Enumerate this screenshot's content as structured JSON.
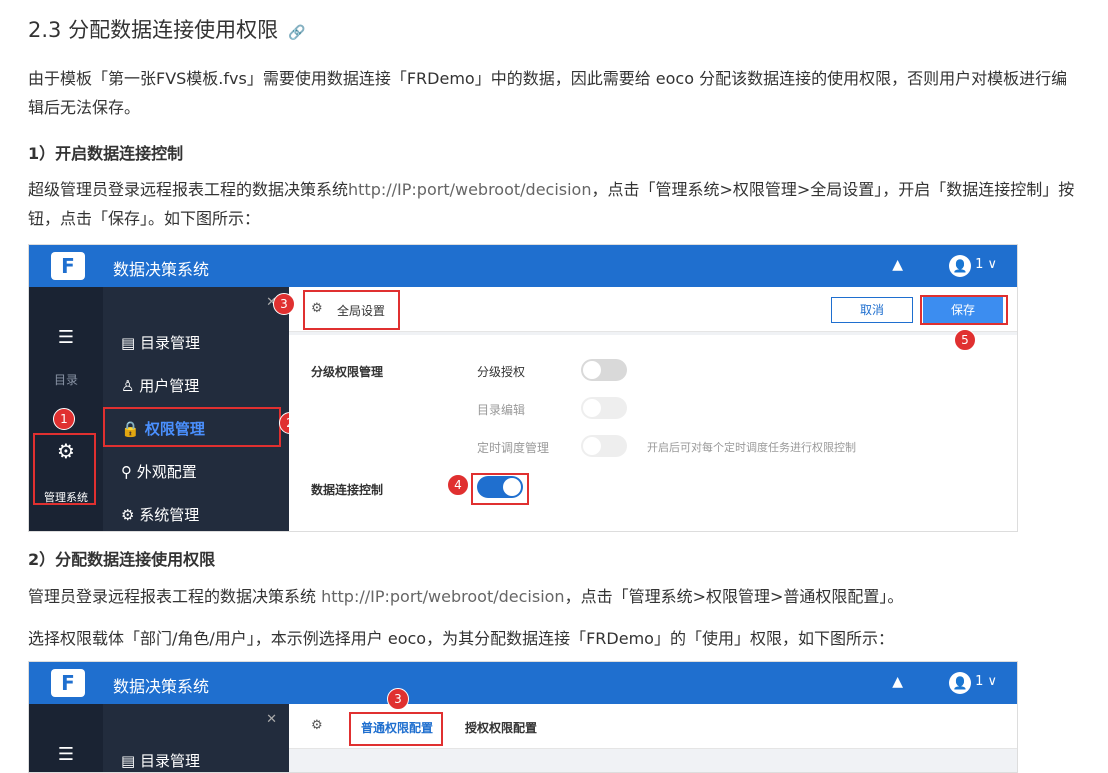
{
  "heading": "2.3 分配数据连接使用权限",
  "heading_link_icon": "link-icon",
  "intro": "由于模板「第一张FVS模板.fvs」需要使用数据连接「FRDemo」中的数据，因此需要给 eoco 分配该数据连接的使用权限，否则用户对模板进行编辑后无法保存。",
  "step1": {
    "title": "1）开启数据连接控制",
    "text_a": "超级管理员登录远程报表工程的数据决策系统",
    "url": "http://IP:port/webroot/decision",
    "text_b": "，点击「管理系统>权限管理>全局设置」，开启「数据连接控制」按钮，点击「保存」。如下图所示："
  },
  "shot1": {
    "app_title": "数据决策系统",
    "user": "1",
    "rail": {
      "catalog": "目录",
      "admin": "管理系统"
    },
    "menu": [
      "目录管理",
      "用户管理",
      "权限管理",
      "外观配置",
      "系统管理"
    ],
    "tab": "全局设置",
    "cancel": "取消",
    "save": "保存",
    "section1": "分级权限管理",
    "opt1": "分级授权",
    "opt2": "目录编辑",
    "opt3": "定时调度管理",
    "opt3_hint": "开启后可对每个定时调度任务进行权限控制",
    "section2": "数据连接控制",
    "badges": [
      "1",
      "2",
      "3",
      "4",
      "5"
    ]
  },
  "step2": {
    "title": "2）分配数据连接使用权限",
    "text_a": "管理员登录远程报表工程的数据决策系统 ",
    "url": "http://IP:port/webroot/decision",
    "text_b": "，点击「管理系统>权限管理>普通权限配置」。",
    "text_c": "选择权限载体「部门/角色/用户」，本示例选择用户 eoco，为其分配数据连接「FRDemo」的「使用」权限，如下图所示："
  },
  "shot2": {
    "app_title": "数据决策系统",
    "user": "1",
    "tab1": "普通权限配置",
    "tab2": "授权权限配置",
    "menu0": "目录管理",
    "badge": "3"
  }
}
